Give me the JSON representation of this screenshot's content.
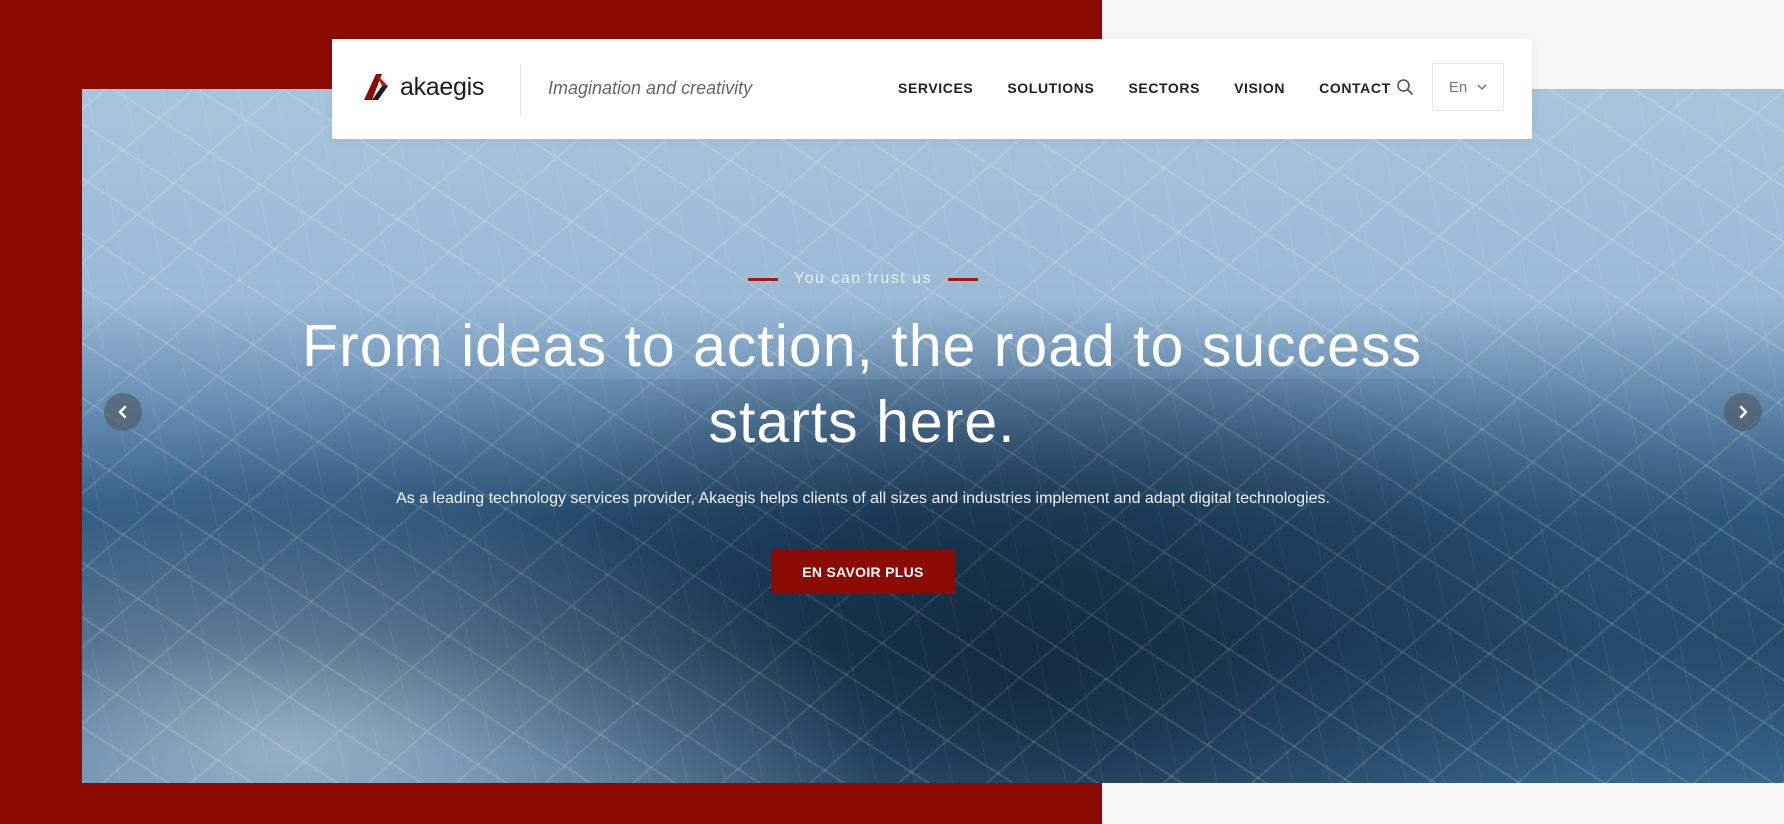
{
  "brand": {
    "name": "akaegis",
    "tagline": "Imagination and creativity"
  },
  "nav": {
    "items": [
      {
        "label": "SERVICES"
      },
      {
        "label": "SOLUTIONS"
      },
      {
        "label": "SECTORS"
      },
      {
        "label": "VISION"
      },
      {
        "label": "CONTACT"
      }
    ],
    "language": "En"
  },
  "hero": {
    "eyebrow": "You can trust us",
    "headline": "From ideas to action, the road to success starts here.",
    "subtext": "As a leading technology services provider, Akaegis helps clients of all sizes and industries implement and adapt digital technologies.",
    "cta_label": "EN SAVOIR PLUS"
  },
  "colors": {
    "brand_red": "#8b0a02",
    "accent_line": "#a3180f"
  },
  "icons": [
    "logo-mark-icon",
    "search-icon",
    "chevron-down-icon",
    "chevron-left-icon",
    "chevron-right-icon"
  ]
}
